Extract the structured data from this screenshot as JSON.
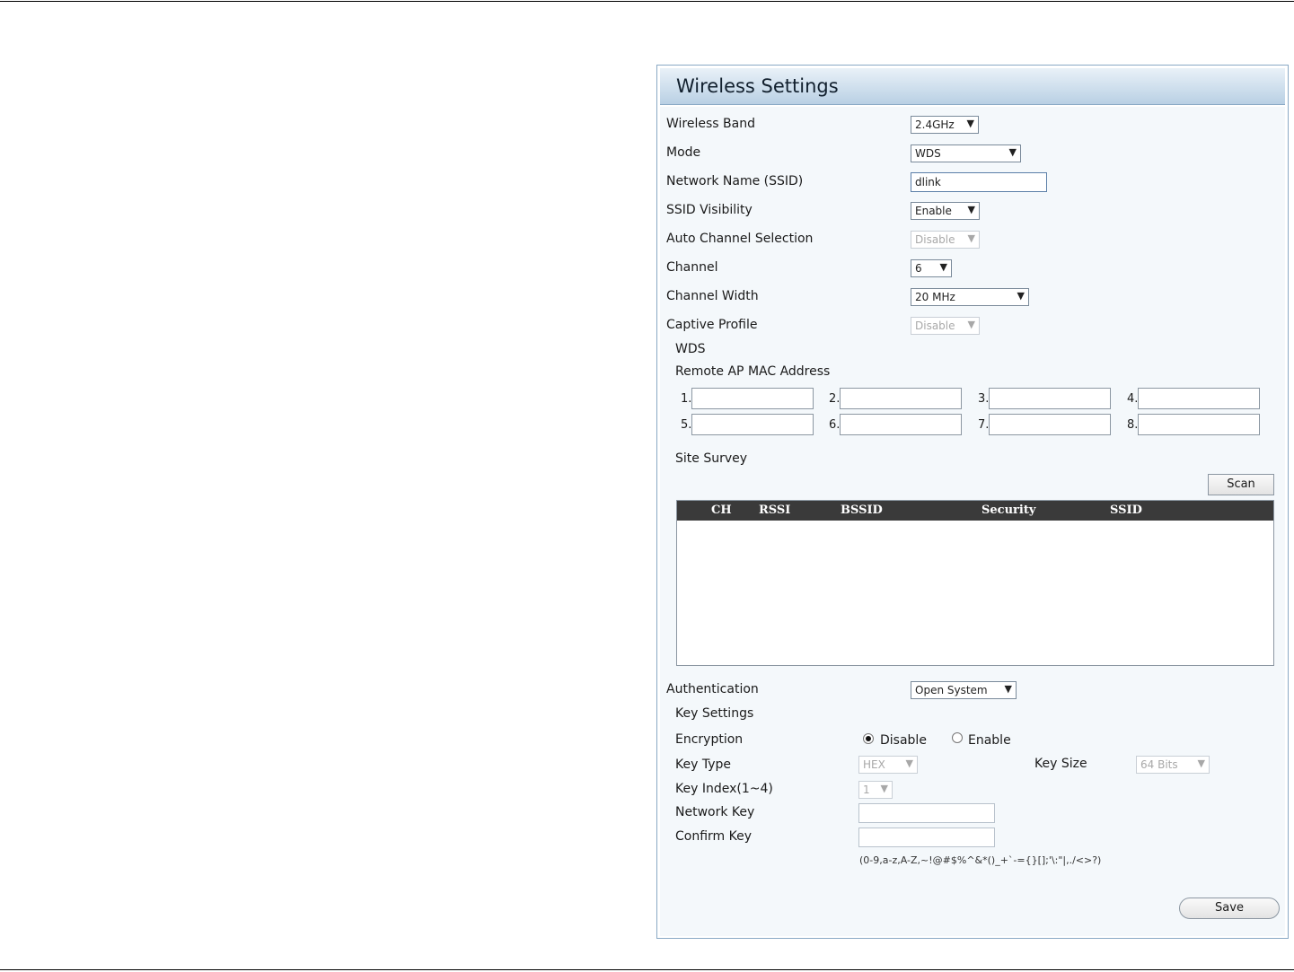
{
  "panel": {
    "title": "Wireless Settings"
  },
  "wireless": {
    "band_label": "Wireless Band",
    "band_value": "2.4GHz",
    "mode_label": "Mode",
    "mode_value": "WDS",
    "ssid_label": "Network Name (SSID)",
    "ssid_value": "dlink",
    "visibility_label": "SSID Visibility",
    "visibility_value": "Enable",
    "auto_channel_label": "Auto Channel Selection",
    "auto_channel_value": "Disable",
    "channel_label": "Channel",
    "channel_value": "6",
    "width_label": "Channel Width",
    "width_value": "20 MHz",
    "captive_label": "Captive Profile",
    "captive_value": "Disable"
  },
  "wds": {
    "title": "WDS",
    "remote_label": "Remote AP MAC Address",
    "mac_numbers": [
      "1.",
      "2.",
      "3.",
      "4.",
      "5.",
      "6.",
      "7.",
      "8."
    ]
  },
  "survey": {
    "title": "Site Survey",
    "scan_label": "Scan",
    "columns": [
      "CH",
      "RSSI",
      "BSSID",
      "Security",
      "SSID"
    ]
  },
  "auth": {
    "label": "Authentication",
    "value": "Open System",
    "key_settings": "Key Settings",
    "encryption_label": "Encryption",
    "disable_label": "Disable",
    "enable_label": "Enable",
    "encryption_selected": "Disable",
    "key_type_label": "Key Type",
    "key_type_value": "HEX",
    "key_size_label": "Key Size",
    "key_size_value": "64 Bits",
    "key_index_label": "Key Index(1~4)",
    "key_index_value": "1",
    "network_key_label": "Network Key",
    "confirm_key_label": "Confirm Key",
    "charset_hint": "(0-9,a-z,A-Z,~!@#$%^&*()_+`-={}[];'\\:\"|,./<>?)"
  },
  "save_label": "Save"
}
